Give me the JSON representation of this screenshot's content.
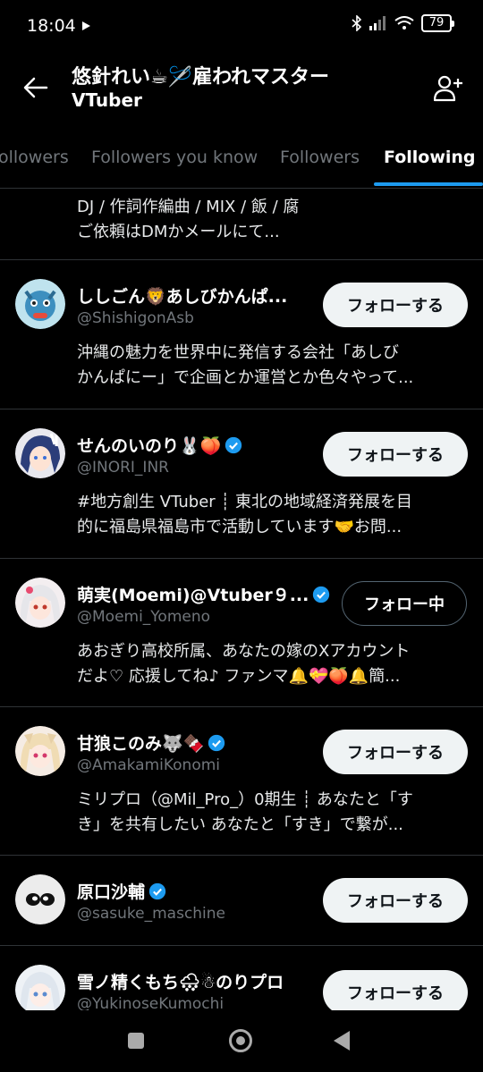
{
  "status": {
    "time": "18:04",
    "battery": "79"
  },
  "header": {
    "title": "悠針れい☕🪡雇われマスター",
    "subtitle": "VTuber"
  },
  "tabs": [
    "ollowers",
    "Followers you know",
    "Followers",
    "Following"
  ],
  "partial_bio": [
    "DJ / 作詞作編曲 / MIX / 飯 / 腐",
    "ご依頼はDMかメールにて..."
  ],
  "users": [
    {
      "name": "ししごん🦁あしびかんぱ...",
      "handle": "@ShishigonAsb",
      "verified": false,
      "button": "フォローする",
      "bio": [
        "沖縄の魅力を世界中に発信する会社「あしび",
        "かんぱにー」で企画とか運営とか色々やって..."
      ]
    },
    {
      "name": "せんのいのり🐰🍑",
      "handle": "@INORI_INR",
      "verified": true,
      "button": "フォローする",
      "bio": [
        "#地方創生 VTuber ┊ 東北の地域経済発展を目",
        "的に福島県福島市で活動しています🤝お問..."
      ]
    },
    {
      "name": "萌実(Moemi)@Vtuber９...",
      "handle": "@Moemi_Yomeno",
      "verified": true,
      "button": "フォロー中",
      "bio": [
        "あおぎり高校所属、あなたの嫁のXアカウント",
        "だよ♡ 応援してね♪ ファンマ🔔💝🍑🔔簡..."
      ]
    },
    {
      "name": "甘狼このみ🐺🍫",
      "handle": "@AmakamiKonomi",
      "verified": true,
      "button": "フォローする",
      "bio": [
        "ミリプロ（@Mil_Pro_）0期生 ┊ あなたと「す",
        "き」を共有したい あなたと「すき」で繋が..."
      ]
    },
    {
      "name": "原口沙輔",
      "handle": "@sasuke_maschine",
      "verified": true,
      "button": "フォローする",
      "bio": []
    },
    {
      "name": "雪ノ精くもち🌨☃のりプロ",
      "handle": "@YukinoseKumochi",
      "verified": false,
      "button": "フォローする",
      "bio": []
    }
  ],
  "colors": {
    "accent": "#1d9bf0",
    "background": "#000000",
    "secondary_text": "#71767b"
  }
}
